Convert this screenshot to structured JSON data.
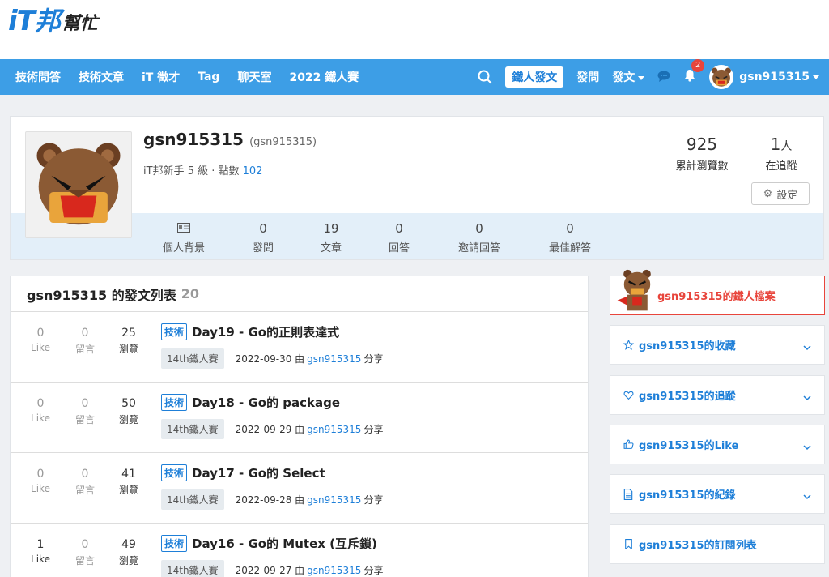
{
  "logo": {
    "it": "iT",
    "bang": "邦",
    "help": "幫忙"
  },
  "nav": {
    "items": [
      "技術問答",
      "技術文章",
      "iT 徵才",
      "Tag",
      "聊天室",
      "2022 鐵人賽"
    ],
    "ironman_button": "鐵人發文",
    "ask": "發問",
    "post": "發文",
    "notification_count": "2",
    "username": "gsn915315"
  },
  "profile": {
    "name": "gsn915315",
    "account": "(gsn915315)",
    "level_text": "iT邦新手 5 級 · 點數",
    "points": "102",
    "views": "925",
    "views_label": "累計瀏覽數",
    "following": "1",
    "following_unit": "人",
    "following_label": "在追蹤",
    "settings": "設定",
    "stats": [
      {
        "num": "",
        "label": "個人背景"
      },
      {
        "num": "0",
        "label": "發問"
      },
      {
        "num": "19",
        "label": "文章"
      },
      {
        "num": "0",
        "label": "回答"
      },
      {
        "num": "0",
        "label": "邀請回答"
      },
      {
        "num": "0",
        "label": "最佳解答"
      }
    ]
  },
  "posts": {
    "title": "gsn915315 的發文列表",
    "count": "20",
    "metric_labels": {
      "like": "Like",
      "reply": "留言",
      "view": "瀏覽"
    },
    "items": [
      {
        "like": "0",
        "reply": "0",
        "views": "25",
        "tag": "技術",
        "title": "Day19 - Go的正則表達式",
        "series": "14th鐵人賽",
        "date": "2022-09-30 由",
        "author": "gsn915315",
        "action": "分享"
      },
      {
        "like": "0",
        "reply": "0",
        "views": "50",
        "tag": "技術",
        "title": "Day18 - Go的 package",
        "series": "14th鐵人賽",
        "date": "2022-09-29 由",
        "author": "gsn915315",
        "action": "分享"
      },
      {
        "like": "0",
        "reply": "0",
        "views": "41",
        "tag": "技術",
        "title": "Day17 - Go的 Select",
        "series": "14th鐵人賽",
        "date": "2022-09-28 由",
        "author": "gsn915315",
        "action": "分享"
      },
      {
        "like": "1",
        "reply": "0",
        "views": "49",
        "tag": "技術",
        "title": "Day16 - Go的 Mutex (互斥鎖)",
        "series": "14th鐵人賽",
        "date": "2022-09-27 由",
        "author": "gsn915315",
        "action": "分享"
      }
    ]
  },
  "sidebar": {
    "ironman_profile": "gsn915315的鐵人檔案",
    "items": [
      {
        "label": "gsn915315的收藏",
        "icon": "star-icon"
      },
      {
        "label": "gsn915315的追蹤",
        "icon": "heart-icon"
      },
      {
        "label": "gsn915315的Like",
        "icon": "thumbs-up-icon"
      },
      {
        "label": "gsn915315的紀錄",
        "icon": "document-icon"
      },
      {
        "label": "gsn915315的訂閱列表",
        "icon": "bookmark-icon"
      }
    ]
  },
  "colors": {
    "brand": "#3d9ee6",
    "link": "#1e7fd8",
    "accent_red": "#e8453c"
  }
}
